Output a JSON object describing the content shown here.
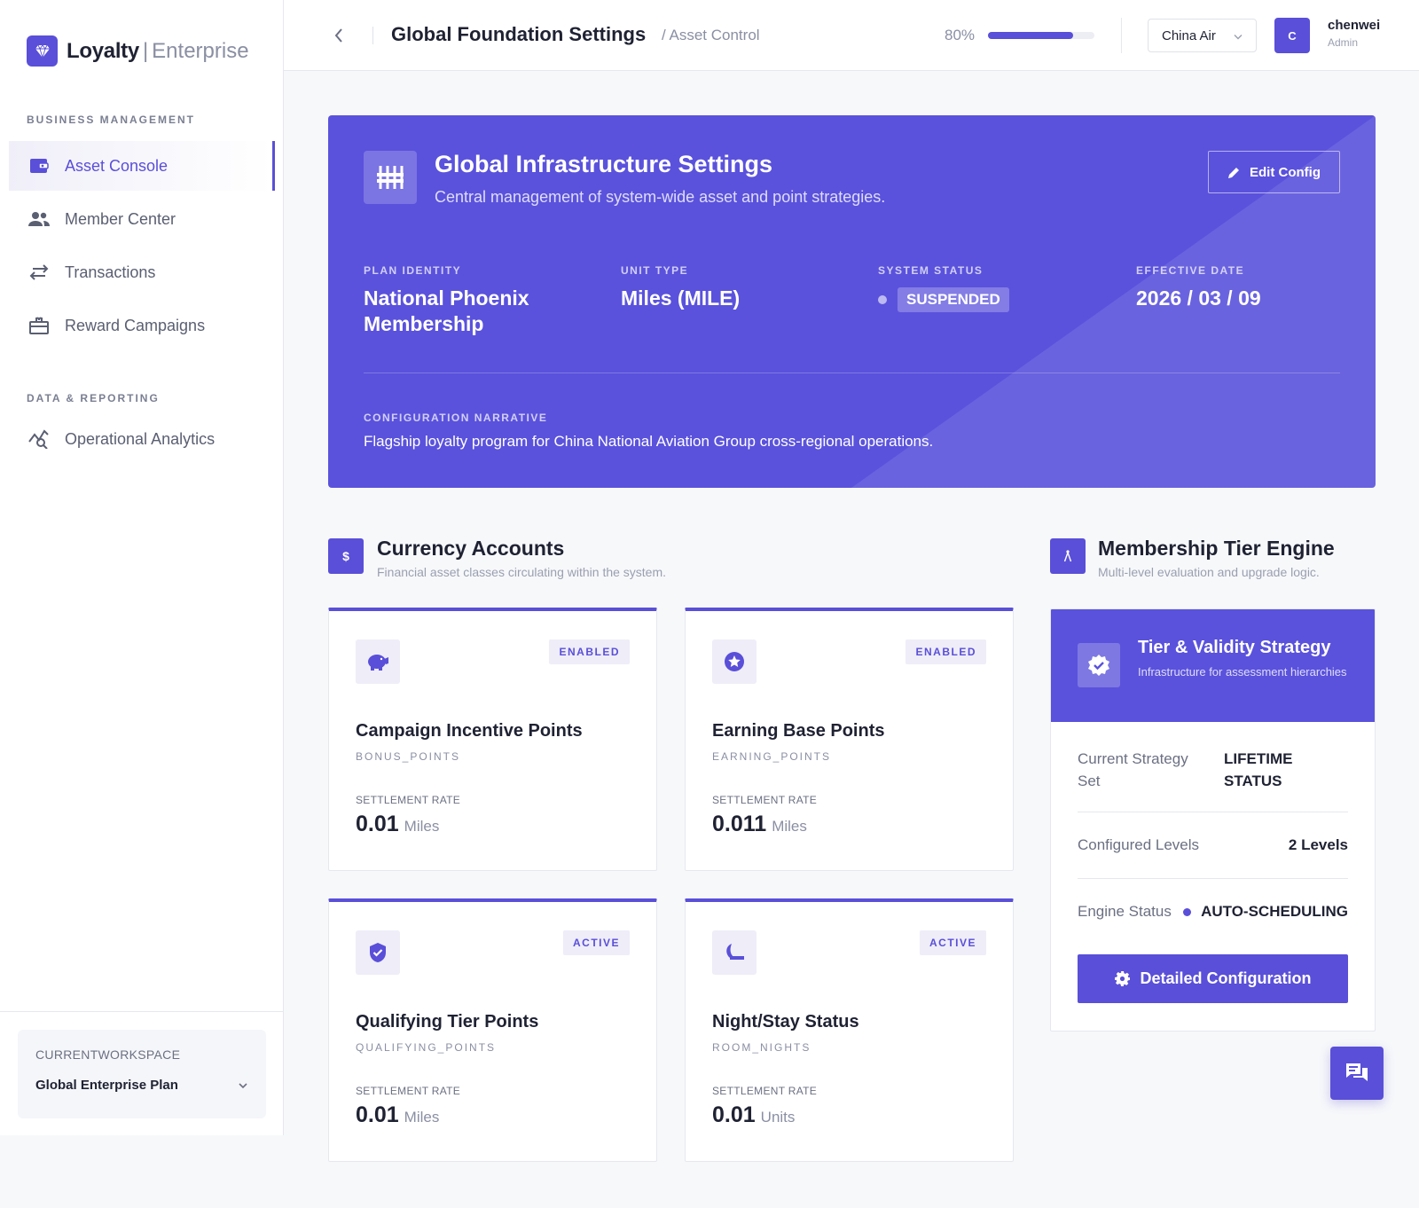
{
  "brand": {
    "name": "Loyalty",
    "separator": "|",
    "suffix": "Enterprise"
  },
  "sidebar": {
    "sections": [
      {
        "title": "BUSINESS MANAGEMENT"
      },
      {
        "title": "DATA & REPORTING"
      }
    ],
    "items": [
      {
        "label": "Asset Console",
        "icon": "wallet-icon",
        "active": true
      },
      {
        "label": "Member Center",
        "icon": "users-icon",
        "active": false
      },
      {
        "label": "Transactions",
        "icon": "exchange-icon",
        "active": false
      },
      {
        "label": "Reward Campaigns",
        "icon": "gift-icon",
        "active": false
      },
      {
        "label": "Operational Analytics",
        "icon": "analytics-icon",
        "active": false
      }
    ],
    "workspace": {
      "label": "CURRENTWORKSPACE",
      "value": "Global Enterprise Plan"
    }
  },
  "header": {
    "title": "Global Foundation Settings",
    "breadcrumb": "/ Asset Control",
    "zoom_label": "80%",
    "progress": 0.8,
    "org": "China Air",
    "avatar_initial": "C",
    "user_name": "chenwei",
    "user_role": "Admin"
  },
  "hero": {
    "title": "Global Infrastructure Settings",
    "subtitle": "Central management of system-wide asset and point strategies.",
    "edit_label": "Edit Config",
    "stats": {
      "plan_label": "PLAN IDENTITY",
      "plan_value_line1": "National Phoenix",
      "plan_value_line2": "Membership",
      "unit_label": "UNIT TYPE",
      "unit_value": "Miles (MILE)",
      "status_label": "SYSTEM STATUS",
      "status_value": "SUSPENDED",
      "date_label": "EFFECTIVE DATE",
      "date_value": "2026 / 03 / 09"
    },
    "narrative_label": "CONFIGURATION NARRATIVE",
    "narrative_text": "Flagship loyalty program for China National Aviation Group cross-regional operations."
  },
  "currency": {
    "icon_text": "$",
    "title": "Currency Accounts",
    "subtitle": "Financial asset classes circulating within the system.",
    "rate_label": "SETTLEMENT RATE",
    "cards": [
      {
        "name": "Campaign Incentive Points",
        "code": "BONUS_POINTS",
        "badge": "ENABLED",
        "rate": "0.01",
        "unit": "Miles",
        "icon": "piggy-bank-icon"
      },
      {
        "name": "Earning Base Points",
        "code": "EARNING_POINTS",
        "badge": "ENABLED",
        "rate": "0.011",
        "unit": "Miles",
        "icon": "star-circle-icon"
      },
      {
        "name": "Qualifying Tier Points",
        "code": "QUALIFYING_POINTS",
        "badge": "ACTIVE",
        "rate": "0.01",
        "unit": "Miles",
        "icon": "shield-check-icon"
      },
      {
        "name": "Night/Stay Status",
        "code": "ROOM_NIGHTS",
        "badge": "ACTIVE",
        "rate": "0.01",
        "unit": "Units",
        "icon": "moon-icon"
      }
    ]
  },
  "tier": {
    "title": "Membership Tier Engine",
    "subtitle": "Multi-level evaluation and upgrade logic.",
    "card_title": "Tier & Validity Strategy",
    "card_subtitle": "Infrastructure for assessment hierarchies",
    "rows": {
      "strategy_label_1": "Current Strategy",
      "strategy_label_2": "Set",
      "strategy_value_1": "LIFETIME",
      "strategy_value_2": "STATUS",
      "levels_label": "Configured Levels",
      "levels_value": "2 Levels",
      "engine_label": "Engine Status",
      "engine_value": "AUTO-SCHEDULING"
    },
    "button_label": "Detailed Configuration"
  },
  "colors": {
    "accent": "#5a4fd8",
    "hero": "#5a52dc"
  }
}
